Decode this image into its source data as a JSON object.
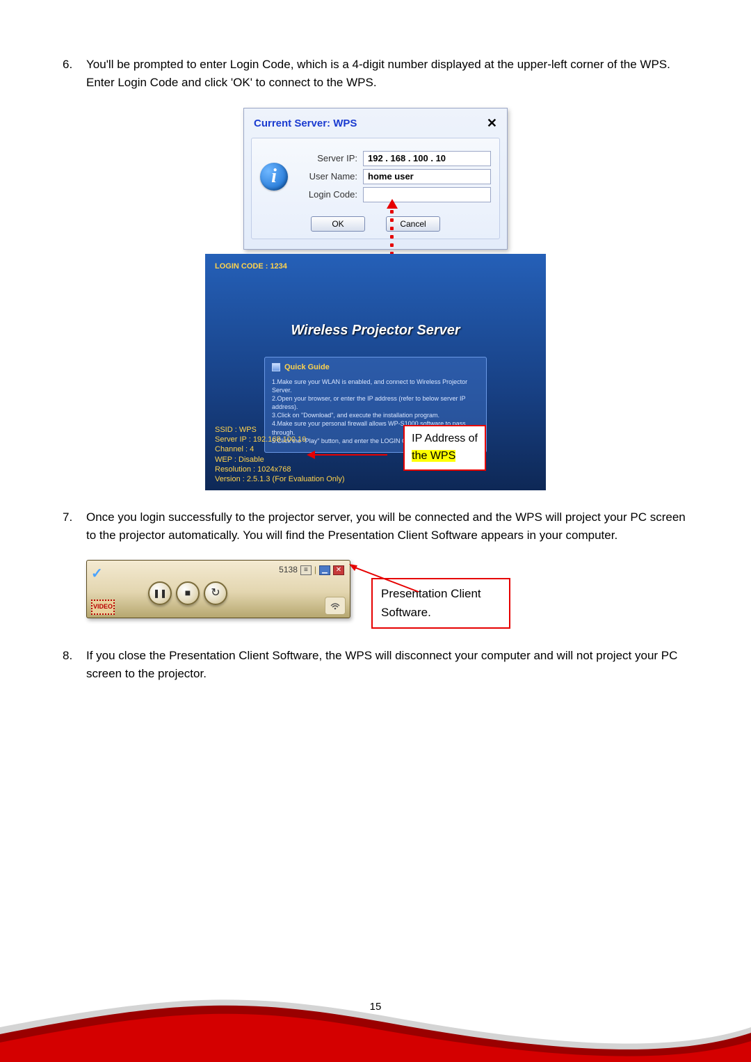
{
  "steps": {
    "s6_num": "6.",
    "s6_text": "You'll be prompted to enter Login Code, which is a 4-digit number displayed at the upper-left corner of the WPS. Enter Login Code and click 'OK' to connect to the WPS.",
    "s7_num": "7.",
    "s7_text": "Once you login successfully to the projector server, you will be connected and the WPS will project your PC screen to the projector automatically. You will find the Presentation Client Software appears in your computer.",
    "s8_num": "8.",
    "s8_text": "If you close the Presentation Client Software, the WPS will disconnect your computer and will not project your PC screen to the projector."
  },
  "dialog": {
    "title": "Current Server: WPS",
    "close": "✕",
    "server_ip_label": "Server IP:",
    "server_ip_value": "192 . 168 . 100 . 10",
    "user_name_label": "User Name:",
    "user_name_value": "home user",
    "login_code_label": "Login Code:",
    "login_code_value": "",
    "ok": "OK",
    "cancel": "Cancel"
  },
  "wps": {
    "login_code": "LOGIN CODE : 1234",
    "title": "Wireless Projector Server",
    "quick_guide_heading": "Quick Guide",
    "guide": {
      "g1": "1.Make sure your WLAN is enabled, and connect to Wireless Projector Server.",
      "g2": "2.Open your browser, or enter the IP address (refer to below server IP address).",
      "g3": "3.Click on \"Download\", and execute the installation program.",
      "g4": "4.Make sure your personal firewall allows WP-S1000 software to pass through.",
      "g5": "5.Click the \"Play\" button, and enter the LOGIN CODE to start projection."
    },
    "info": {
      "ssid": "SSID : WPS",
      "server_ip": "Server IP : 192.168.100.10",
      "channel": "Channel : 4",
      "wep": "WEP : Disable",
      "resolution": "Resolution : 1024x768",
      "version": "Version : 2.5.1.3 (For Evaluation Only)"
    },
    "callout_line1": "IP Address of",
    "callout_line2": "the WPS"
  },
  "client": {
    "code": "5138",
    "video_badge": "VIDEO",
    "callout": "Presentation Client Software."
  },
  "page_number": "15",
  "icons": {
    "info": "i",
    "pause": "❚❚",
    "stop": "■",
    "refresh": "↻",
    "wifi": "⌃",
    "list": "≡",
    "min": "▁",
    "close": "✕",
    "check": "✓"
  }
}
